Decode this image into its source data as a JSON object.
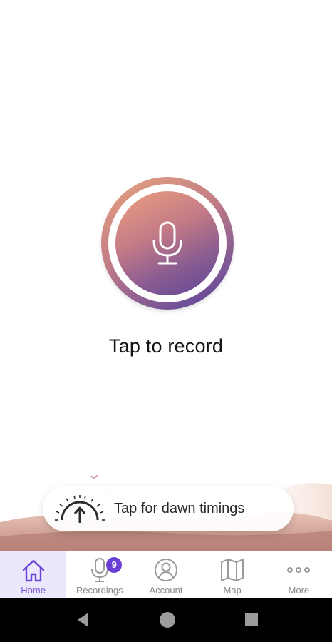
{
  "record": {
    "label": "Tap to record"
  },
  "dawn_card": {
    "text": "Tap for dawn timings"
  },
  "bottom_nav": {
    "items": [
      {
        "label": "Home",
        "icon": "home-icon",
        "active": true
      },
      {
        "label": "Recordings",
        "icon": "microphone-icon",
        "badge": "9"
      },
      {
        "label": "Account",
        "icon": "account-icon"
      },
      {
        "label": "Map",
        "icon": "map-icon"
      },
      {
        "label": "More",
        "icon": "more-dots-icon"
      }
    ]
  },
  "system_nav": {
    "buttons": [
      "back-icon",
      "home-circle-icon",
      "recents-icon"
    ]
  },
  "colors": {
    "accent": "#7a56d8",
    "badge": "#6a3fd6",
    "gradient_start": "#eca07e",
    "gradient_end": "#5e4797",
    "landscape": "#cc9a88"
  }
}
